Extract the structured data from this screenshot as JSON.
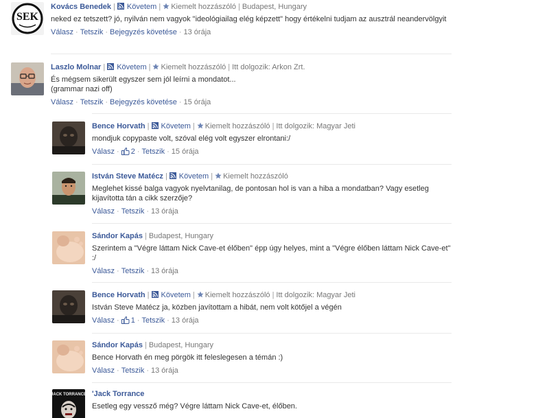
{
  "labels": {
    "follow": "Követem",
    "featured": "Kiemelt hozzászóló",
    "reply": "Válasz",
    "like": "Tetszik",
    "follow_post": "Bejegyzés követése"
  },
  "colors": {
    "link": "#3b5998",
    "meta": "#777777",
    "text": "#333333",
    "divider": "#e9e9e9"
  },
  "comments": [
    {
      "author": "Kovács Benedek",
      "avatar_icon": "sek-logo-avatar",
      "follow": true,
      "featured": true,
      "extra": "Budapest, Hungary",
      "text": "neked ez tetszett? jó, nyilván nem vagyok \"ideológiailag elég képzett\" hogy értékelni tudjam az ausztrál neandervölgyit",
      "likes": null,
      "follow_post": true,
      "time": "13 órája"
    },
    {
      "author": "Laszlo Molnar",
      "avatar_icon": "man-glasses-avatar",
      "follow": true,
      "featured": true,
      "extra": "Itt dolgozik: Arkon Zrt.",
      "text": "És mégsem sikerült egyszer sem jól leírni a mondatot...\n(grammar nazi off)",
      "likes": null,
      "follow_post": true,
      "time": "15 órája"
    },
    {
      "author": "Bence Horvath",
      "avatar_icon": "dark-person-avatar",
      "follow": true,
      "featured": true,
      "extra": "Itt dolgozik: Magyar Jeti",
      "text": "mondjuk copypaste volt, szóval elég volt egyszer elrontani:/",
      "likes": "2",
      "follow_post": false,
      "time": "15 órája"
    },
    {
      "author": "István Steve Matécz",
      "avatar_icon": "young-man-avatar",
      "follow": true,
      "featured": true,
      "extra": "",
      "text": "Meglehet kissé balga vagyok nyelvtanilag, de pontosan hol is van a hiba a mondatban? Vagy esetleg kijavította tán a cikk szerzője?",
      "likes": null,
      "follow_post": false,
      "time": "13 órája"
    },
    {
      "author": "Sándor Kapás",
      "avatar_icon": "baby-feet-avatar",
      "follow": false,
      "featured": false,
      "extra": "Budapest, Hungary",
      "text": "Szerintem a \"Végre láttam Nick Cave-et élőben\" épp úgy helyes, mint a \"Végre élőben láttam Nick Cave-et\" :/",
      "likes": null,
      "follow_post": false,
      "time": "13 órája"
    },
    {
      "author": "Bence Horvath",
      "avatar_icon": "dark-person-avatar",
      "follow": true,
      "featured": true,
      "extra": "Itt dolgozik: Magyar Jeti",
      "text": "István Steve Matécz ja, közben javítottam a hibát, nem volt kötőjel a végén",
      "likes": "1",
      "follow_post": false,
      "time": "13 órája"
    },
    {
      "author": "Sándor Kapás",
      "avatar_icon": "baby-feet-avatar",
      "follow": false,
      "featured": false,
      "extra": "Budapest, Hungary",
      "text": "Bence Horvath én meg pörgök itt feleslegesen a témán :)",
      "likes": null,
      "follow_post": false,
      "time": "13 órája"
    },
    {
      "author": "'Jack Torrance",
      "avatar_icon": "jack-torrance-avatar",
      "follow": false,
      "featured": false,
      "extra": "",
      "text": "Esetleg egy vessző még? Végre láttam Nick Cave-et, élőben.",
      "likes": null,
      "follow_post": false,
      "time": ""
    }
  ]
}
